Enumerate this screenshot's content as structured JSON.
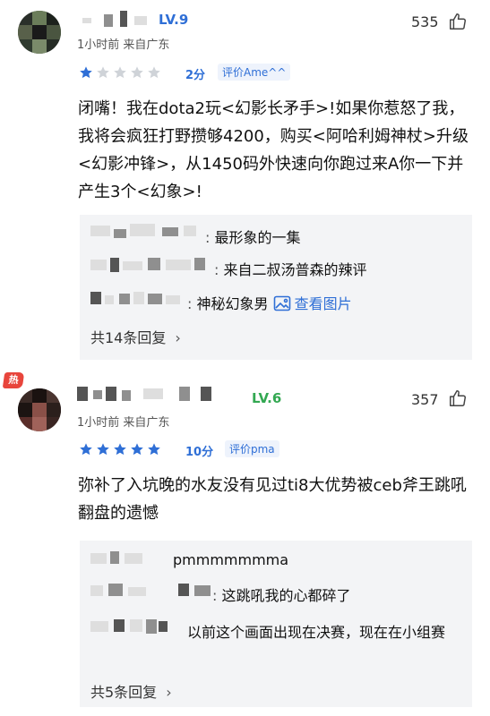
{
  "comments": [
    {
      "level": "LV.9",
      "meta": "1小时前 来自广东",
      "likes": "535",
      "stars": 1,
      "score": "2分",
      "rating_tag": "评价Ame^^",
      "text": "闭嘴！我在dota2玩<幻影长矛手>!如果你惹怒了我，我将会疯狂打野攒够4200，购买<阿哈利姆神杖>升级<幻影冲锋>，从1450码外快速向你跑过来A你一下并产生3个<幻象>!",
      "replies": [
        {
          "text": "最形象的一集"
        },
        {
          "text": "来自二叔汤普森的辣评"
        },
        {
          "text": "神秘幻象男",
          "link": "查看图片"
        }
      ],
      "more": "共14条回复"
    },
    {
      "hot_badge": "热",
      "level": "LV.6",
      "meta": "1小时前 来自广东",
      "likes": "357",
      "stars": 5,
      "score": "10分",
      "rating_tag": "评价pma",
      "text": "弥补了入坑晚的水友没有见过ti8大优势被ceb斧王跳吼翻盘的遗憾",
      "replies": [
        {
          "text": "pmmmmmmma"
        },
        {
          "text": "这跳吼我的心都碎了"
        },
        {
          "text": "以前这个画面出现在决赛，现在在小组赛"
        }
      ],
      "more": "共5条回复"
    }
  ],
  "colors": {
    "level_blue": "#2f6fd6",
    "level_green": "#33a852",
    "star_blue": "#2f6fd6",
    "star_gray": "#cfd3d8",
    "hot_red": "#e8453c",
    "reply_bg": "#f3f4f6"
  }
}
